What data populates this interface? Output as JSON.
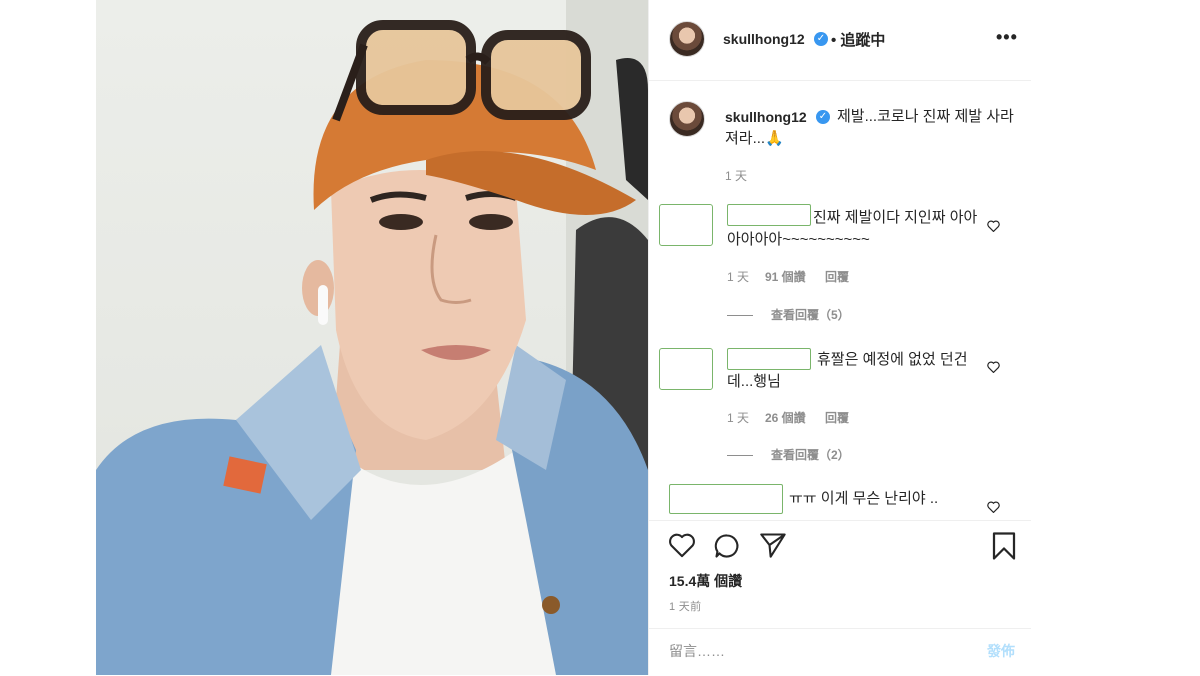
{
  "header": {
    "username": "skullhong12",
    "verified_mark": "✓",
    "follow_status": "• 追蹤中",
    "more_icon": "more-horizontal-icon"
  },
  "caption": {
    "username": "skullhong12",
    "text": "제발...코로나 진짜 제발 사라져라...🙏",
    "time": "1 天"
  },
  "comments": [
    {
      "text": "진짜 제발이다 지인짜 아아아아아아~~~~~~~~~~",
      "time": "1 天",
      "likes": "91 個讚",
      "reply_label": "回覆",
      "view_replies": "查看回覆（5）"
    },
    {
      "text": "휴짤은 예정에 없었 던건데...행님",
      "time": "1 天",
      "likes": "26 個讚",
      "reply_label": "回覆",
      "view_replies": "查看回覆（2）"
    },
    {
      "text": "ㅠㅠ 이게 무슨 난리야 .."
    }
  ],
  "actions": {
    "like_icon": "heart-icon",
    "comment_icon": "comment-icon",
    "share_icon": "send-icon",
    "save_icon": "bookmark-icon"
  },
  "likes_count": "15.4萬 個讚",
  "posted": "1 天前",
  "comment_box": {
    "placeholder": "留言……",
    "post_label": "發佈"
  },
  "colors": {
    "verified": "#3897f0",
    "post_button_disabled": "#b2dffc",
    "meta_gray": "#8e8e8e",
    "redaction_box": "#7ab56b"
  }
}
